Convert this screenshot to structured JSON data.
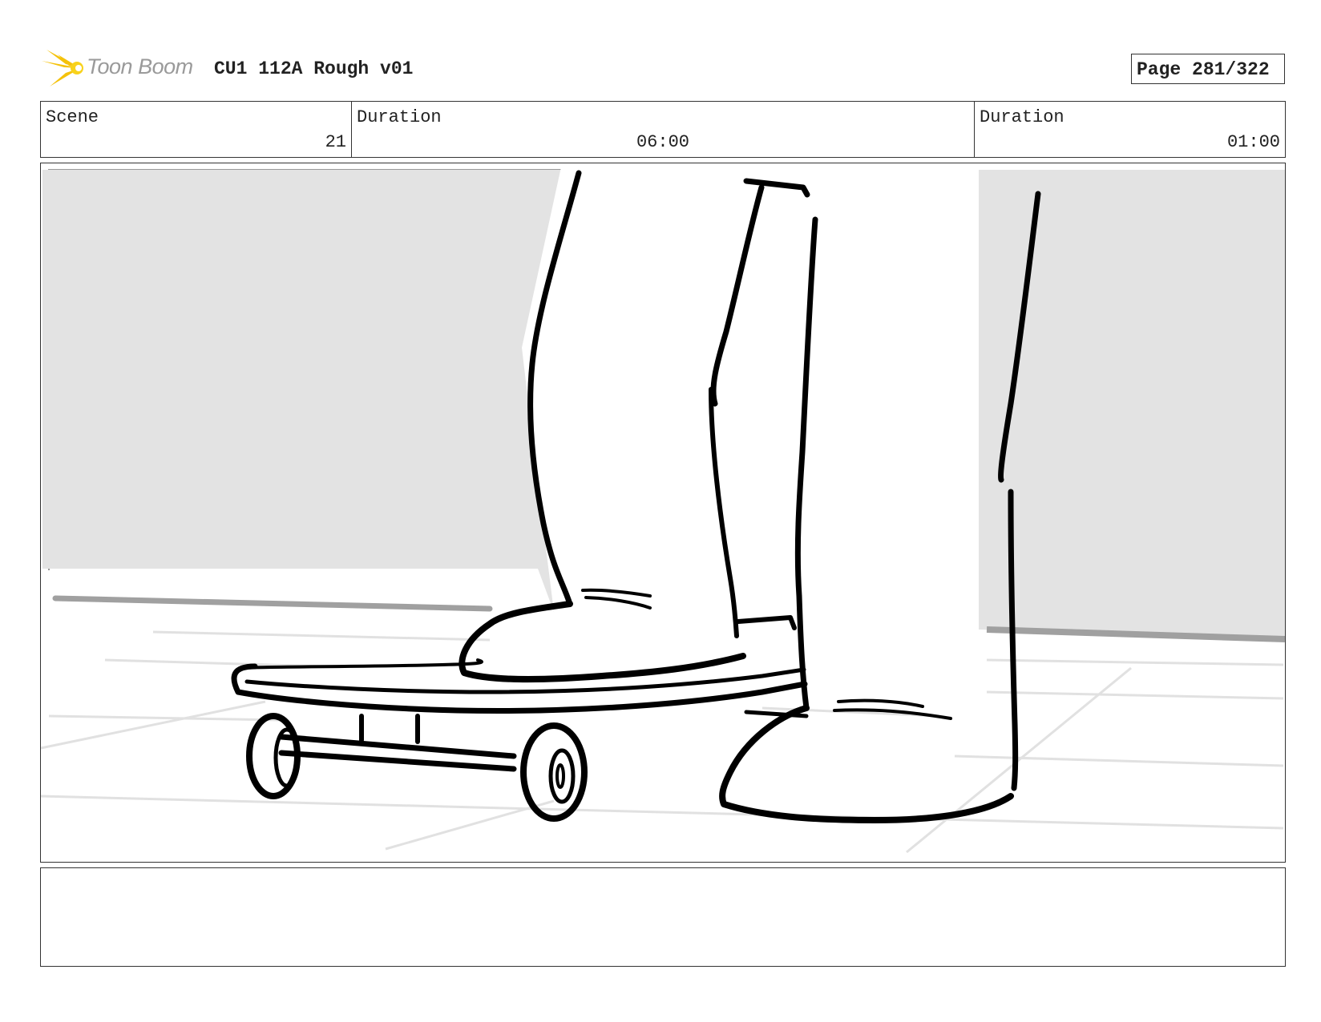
{
  "header": {
    "logo_text": "Toon Boom",
    "logo_icon": "toon-boom-burst-icon",
    "title": "CU1 112A Rough v01",
    "page_label": "Page 281/322"
  },
  "info": {
    "scene_label": "Scene",
    "scene_value": "21",
    "panel_duration_label": "Duration",
    "panel_duration_value": "06:00",
    "scene_duration_label": "Duration",
    "scene_duration_value": "01:00"
  },
  "panel": {
    "image": "storyboard-drawing-feet-on-skateboard"
  },
  "notes": {
    "text": ""
  },
  "colors": {
    "border": "#333333",
    "logo_yellow": "#f5c20a",
    "logo_text": "#9a9a9a",
    "wall": "#e3e3e3",
    "floor_lines": "#e1e1e1",
    "ink": "#000000"
  }
}
